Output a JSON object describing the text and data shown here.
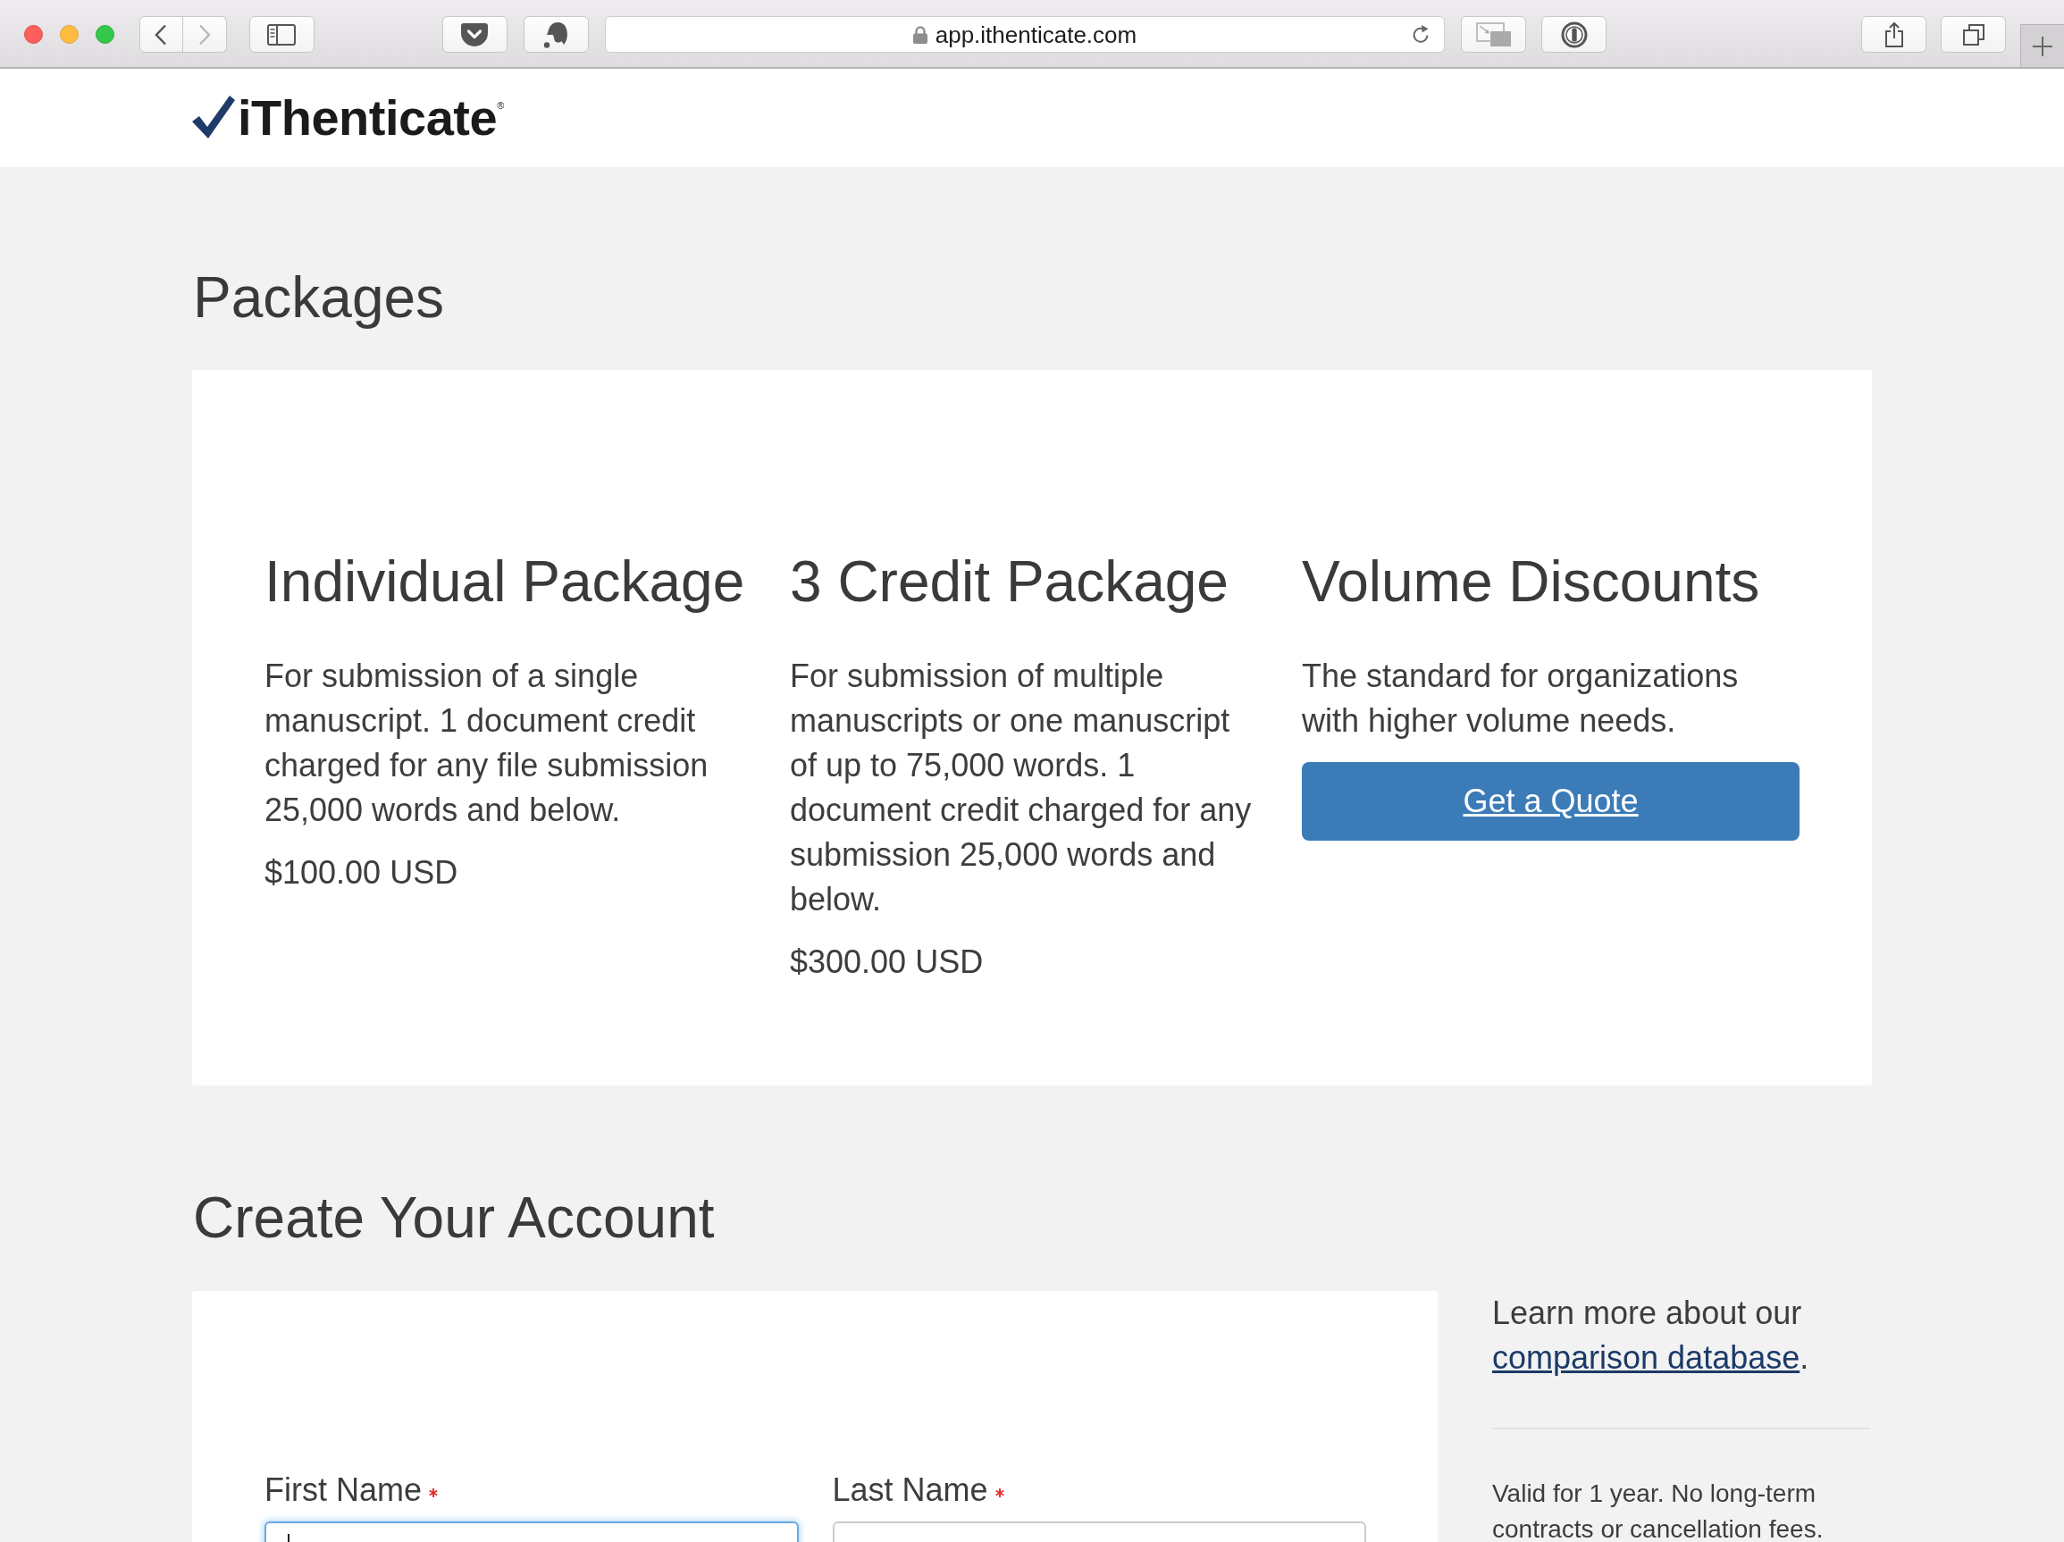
{
  "browser": {
    "url": "app.ithenticate.com",
    "nav_buttons": [
      {
        "kind": "back",
        "disabled": false
      },
      {
        "kind": "forward",
        "disabled": true
      }
    ]
  },
  "header": {
    "logo": "iThenticate$^{®}$"
  },
  "packages": {
    "title": "Packages",
    "items": [
      {
        "kind": "priced",
        "title": "Individual Package",
        "description": "For submission of a single manuscript. 1 document credit charged for any file submission 25,000 words and below.",
        "price": "$100.00 USD"
      },
      {
        "kind": "priced",
        "title": "3 Credit Package",
        "description": "For submission of multiple manuscripts or one manuscript of up to 75,000 words. 1 document credit charged for any submission 25,000 words and below.",
        "price": "$300.00 USD"
      },
      {
        "kind": "quote",
        "title": "Volume Discounts",
        "description": "The standard for organizations with higher volume needs.",
        "button": "Get a Quote"
      }
    ]
  },
  "account": {
    "title": "Create Your Account",
    "fields": [
      {
        "label": "First Name",
        "required": true,
        "focused": true
      },
      {
        "label": "Last Name",
        "required": true,
        "focused": false
      }
    ],
    "info": {
      "text": "Learn more about our",
      "link": "comparison database",
      "text_after": "."
    },
    "note": "Valid for 1 year. No long-term contracts or cancellation fees."
  }
}
